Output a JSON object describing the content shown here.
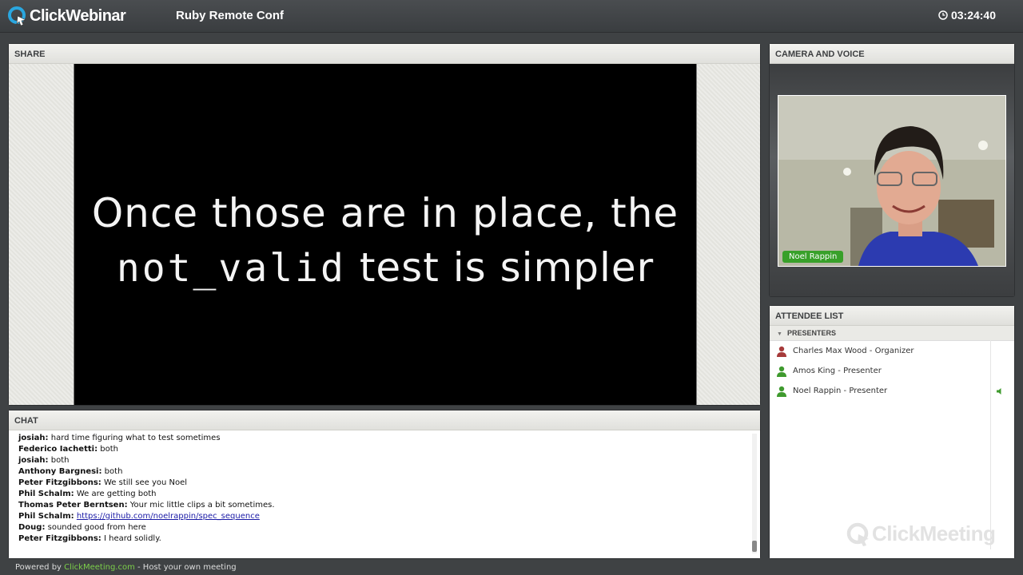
{
  "app": {
    "name": "ClickWebinar",
    "conference_title": "Ruby Remote Conf",
    "timer": "03:24:40"
  },
  "share": {
    "header": "SHARE",
    "slide": {
      "line1": "Once those are in place, the",
      "line2_code": "not_valid",
      "line2_rest": " test is simpler"
    }
  },
  "chat": {
    "header": "CHAT",
    "messages": [
      {
        "author": "josiah:",
        "text": " hard time figuring what to test sometimes"
      },
      {
        "author": "Federico Iachetti:",
        "text": " both"
      },
      {
        "author": "josiah:",
        "text": " both"
      },
      {
        "author": "Anthony Bargnesi:",
        "text": " both"
      },
      {
        "author": "Peter Fitzgibbons:",
        "text": " We still see you Noel"
      },
      {
        "author": "Phil Schalm:",
        "text": " We are getting both"
      },
      {
        "author": "Thomas Peter Berntsen:",
        "text": " Your mic little clips a bit sometimes."
      },
      {
        "author": "Phil Schalm:",
        "text": " ",
        "link": "https://github.com/noelrappin/spec_sequence"
      },
      {
        "author": "Doug:",
        "text": " sounded good from here"
      },
      {
        "author": "Peter Fitzgibbons:",
        "text": " I heard solidly."
      }
    ]
  },
  "camera": {
    "header": "CAMERA AND VOICE",
    "name_tag": "Noel Rappin"
  },
  "attendees": {
    "header": "ATTENDEE LIST",
    "group": "PRESENTERS",
    "list": [
      {
        "name": "Charles Max Wood - Organizer",
        "icon": "organizer-icon",
        "color": "#a63a3a"
      },
      {
        "name": "Amos King - Presenter",
        "icon": "presenter-icon",
        "color": "#3f9a2e"
      },
      {
        "name": "Noel Rappin - Presenter",
        "icon": "presenter-icon",
        "color": "#3f9a2e"
      }
    ],
    "watermark": "ClickMeeting"
  },
  "footer": {
    "prefix": "Powered by ",
    "link": "ClickMeeting.com",
    "suffix": " - Host your own meeting"
  }
}
